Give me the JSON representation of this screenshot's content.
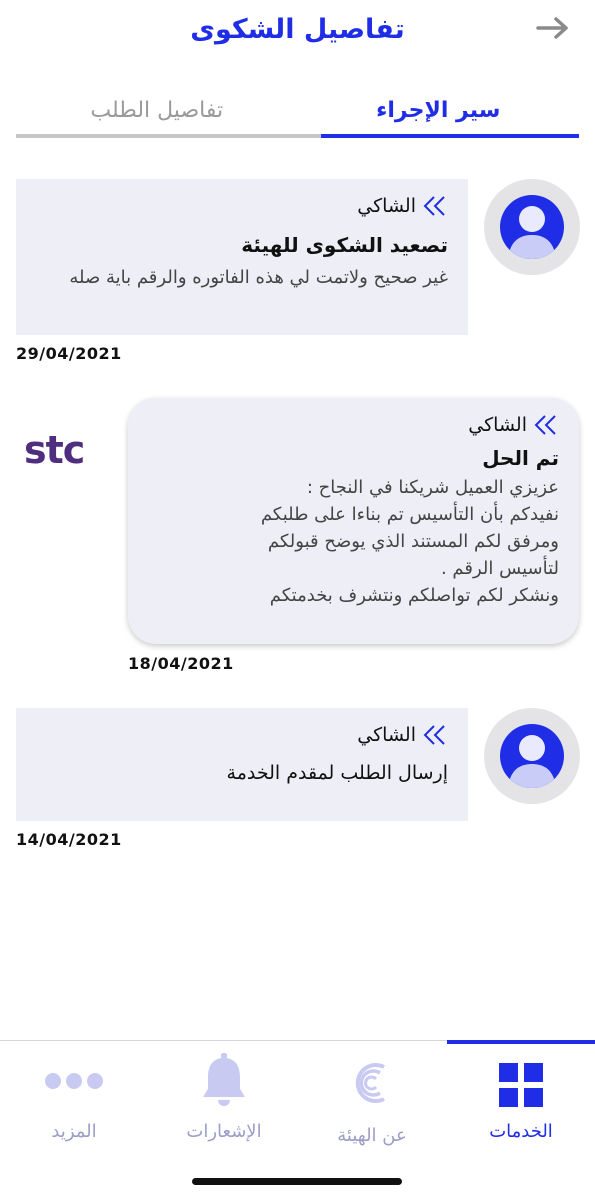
{
  "header": {
    "title": "تفاصيل الشكوى",
    "back_icon": "arrow-right-icon"
  },
  "tabs": [
    {
      "label": "سير الإجراء",
      "active": true
    },
    {
      "label": "تفاصيل الطلب",
      "active": false
    }
  ],
  "timeline": [
    {
      "sender": "الشاكي",
      "status": "تصعيد الشكوى للهيئة",
      "body": "غير صحيح ولاتمت لي هذه الفاتوره والرقم باية صله",
      "date": "29/04/2021",
      "avatar_icon": "user-avatar-icon"
    },
    {
      "sender": "الشاكي",
      "status": "تم الحل",
      "body": "عزيزي العميل شريكنا في النجاح :\nنفيدكم بأن التأسيس تم بناءا على طلبكم\nومرفق لكم المستند الذي يوضح قبولكم\nلتأسيس الرقم .\nونشكر لكم تواصلكم ونتشرف بخدمتكم",
      "date": "18/04/2021",
      "logo_text": "stc"
    },
    {
      "sender": "الشاكي",
      "status": "إرسال الطلب لمقدم الخدمة",
      "date": "14/04/2021",
      "avatar_icon": "user-avatar-icon"
    }
  ],
  "bottom_nav": [
    {
      "label": "الخدمات",
      "icon": "grid-icon",
      "active": true
    },
    {
      "label": "عن الهيئة",
      "icon": "authority-logo-icon",
      "active": false
    },
    {
      "label": "الإشعارات",
      "icon": "bell-icon",
      "active": false
    },
    {
      "label": "المزيد",
      "icon": "more-dots-icon",
      "active": false
    }
  ],
  "colors": {
    "accent": "#1f2ee6",
    "inactive": "#c9caf2",
    "card_bg": "#eeeff6",
    "stc": "#4f2d7f"
  }
}
